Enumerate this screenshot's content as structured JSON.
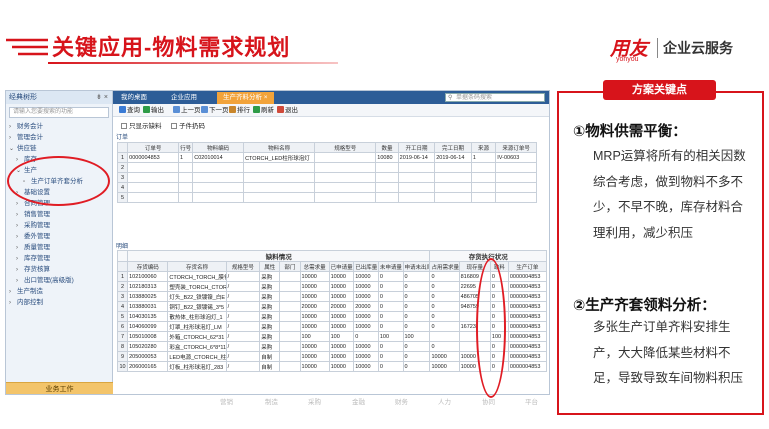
{
  "slide": {
    "title": "关键应用-物料需求规划",
    "logo_mark": "用友",
    "logo_sub": "yonyou",
    "logo_text": "企业云服务"
  },
  "sidebar": {
    "header": "经典树形",
    "header_controls": "⇟ ×",
    "search_placeholder": "请输入您要搜索的功能",
    "items": [
      {
        "label": "财务会计",
        "indent": 0,
        "caret": "›"
      },
      {
        "label": "管理会计",
        "indent": 0,
        "caret": "›"
      },
      {
        "label": "供应链",
        "indent": 0,
        "caret": "⌄"
      },
      {
        "label": "库存",
        "indent": 1,
        "caret": "›"
      },
      {
        "label": "生产",
        "indent": 1,
        "caret": "⌄"
      },
      {
        "label": "生产订单齐套分析",
        "indent": 2,
        "caret": "▫"
      },
      {
        "label": "基础设置",
        "indent": 1,
        "caret": "›"
      },
      {
        "label": "合同管理",
        "indent": 1,
        "caret": "›"
      },
      {
        "label": "销售管理",
        "indent": 1,
        "caret": "›"
      },
      {
        "label": "采购管理",
        "indent": 1,
        "caret": "›"
      },
      {
        "label": "委外管理",
        "indent": 1,
        "caret": "›"
      },
      {
        "label": "质量管理",
        "indent": 1,
        "caret": "›"
      },
      {
        "label": "库存管理",
        "indent": 1,
        "caret": "›"
      },
      {
        "label": "存货核算",
        "indent": 1,
        "caret": "›"
      },
      {
        "label": "出口管理(高级版)",
        "indent": 1,
        "caret": "›"
      },
      {
        "label": "生产制造",
        "indent": 0,
        "caret": "›"
      },
      {
        "label": "内部控制",
        "indent": 0,
        "caret": "›"
      }
    ],
    "bottom_label": "业务工作"
  },
  "tabs": [
    {
      "label": "我的桌面"
    },
    {
      "label": "企业应用"
    },
    {
      "label": "生产齐料分析 ×"
    }
  ],
  "search_placeholder": "单据条码搜索",
  "toolbar": {
    "items": [
      {
        "label": "查询",
        "color": "#3a7bd5"
      },
      {
        "label": "输出",
        "color": "#2e9b47"
      },
      {
        "label": "上一页",
        "color": "#5a8fd6"
      },
      {
        "label": "下一页",
        "color": "#5a8fd6"
      },
      {
        "label": "排行",
        "color": "#c9862b"
      },
      {
        "label": "刷新",
        "color": "#2e9b47"
      },
      {
        "label": "退出",
        "color": "#d04a3a"
      }
    ]
  },
  "filters": {
    "only_shortage": "只显示缺料",
    "sub_items": "子件扔码"
  },
  "orders": {
    "label": "订单",
    "headers": [
      "订单号",
      "行号",
      "物料编码",
      "物料名称",
      "规格型号",
      "数量",
      "开工日期",
      "完工日期",
      "来源",
      "来源订单号"
    ],
    "rows": [
      [
        "0000004853",
        "1",
        "C02010014",
        "CTORCH_LED柱形球泡灯",
        "",
        "10080",
        "2019-06-14",
        "2019-06-14",
        "1",
        "IV-00603"
      ],
      [
        "",
        "",
        "",
        "",
        "",
        "",
        "",
        "",
        "",
        ""
      ],
      [
        "",
        "",
        "",
        "",
        "",
        "",
        "",
        "",
        "",
        ""
      ],
      [
        "",
        "",
        "",
        "",
        "",
        "",
        "",
        "",
        "",
        ""
      ],
      [
        "",
        "",
        "",
        "",
        "",
        "",
        "",
        "",
        "",
        ""
      ]
    ]
  },
  "details": {
    "label": "明细",
    "group_left": "缺料情况",
    "group_right": "存货执行状况",
    "headers": [
      "存货编码",
      "存货名称",
      "规格型号",
      "属性",
      "部门",
      "总需求量",
      "已申请量",
      "已出库量",
      "未申请量",
      "申请未出库量",
      "占用需求量",
      "现存量",
      "缺料",
      "生产订单"
    ],
    "rows": [
      [
        "102100060",
        "CTORCH_TORCH_膜包",
        "/",
        "采购",
        "",
        "10000",
        "10000",
        "10000",
        "0",
        "0",
        "0",
        "816809",
        "0",
        "0000004853"
      ],
      [
        "102180313",
        "塑壳装_TORCH_CTORC",
        "/",
        "采购",
        "",
        "10000",
        "10000",
        "10000",
        "0",
        "0",
        "0",
        "22695",
        "0",
        "0000004853"
      ],
      [
        "103880025",
        "灯头_B22_铁镀镍_白E",
        "/",
        "采购",
        "",
        "10000",
        "10000",
        "10000",
        "0",
        "0",
        "0",
        "486705",
        "0",
        "0000004853"
      ],
      [
        "103880031",
        "铜钉_B22_银镀锡_3*5",
        "/",
        "采购",
        "",
        "20000",
        "20000",
        "20000",
        "0",
        "0",
        "0",
        "948759",
        "0",
        "0000004853"
      ],
      [
        "104030135",
        "散热体_柱形球泡灯_1",
        "/",
        "采购",
        "",
        "10000",
        "10000",
        "10000",
        "0",
        "0",
        "0",
        "",
        "0",
        "0000004853"
      ],
      [
        "104060099",
        "灯罩_柱形球泡灯_LM",
        "/",
        "采购",
        "",
        "10000",
        "10000",
        "10000",
        "0",
        "0",
        "0",
        "16723",
        "0",
        "0000004853"
      ],
      [
        "105010008",
        "外箱_CTORCH_62*31",
        "/",
        "采购",
        "",
        "100",
        "100",
        "0",
        "100",
        "100",
        "",
        "",
        "100",
        "0000004853"
      ],
      [
        "105020280",
        "彩盒_CTORCH_6*8*11",
        "/",
        "采购",
        "",
        "10000",
        "10000",
        "10000",
        "0",
        "0",
        "0",
        "",
        "0",
        "0000004853"
      ],
      [
        "205000053",
        "LED电源_CTORCH_柱",
        "/",
        "自制",
        "",
        "10000",
        "10000",
        "10000",
        "0",
        "0",
        "10000",
        "10000",
        "0",
        "0000004853"
      ],
      [
        "206000165",
        "灯板_柱形球泡灯_283",
        "/",
        "自制",
        "",
        "10000",
        "10000",
        "10000",
        "0",
        "0",
        "10000",
        "10000",
        "0",
        "0000004853"
      ]
    ]
  },
  "bottom_nav": [
    "营销",
    "制造",
    "采购",
    "金融",
    "财务",
    "人力",
    "协同",
    "平台"
  ],
  "panel": {
    "badge": "方案关键点",
    "point1_title": "①物料供需平衡：",
    "point1_text": "MRP运算将所有的相关因数综合考虑，做到物料不多不少，不早不晚，库存材料合理利用，减少积压",
    "point2_title": "②生产齐套领料分析：",
    "point2_text": "多张生产订单齐料安排生产，大大降低某些材料不足，导致导致车间物料积压"
  },
  "colors": {
    "brand_red": "#d7141b",
    "nav_blue": "#2d5d97",
    "tab_orange": "#f2a33a"
  }
}
